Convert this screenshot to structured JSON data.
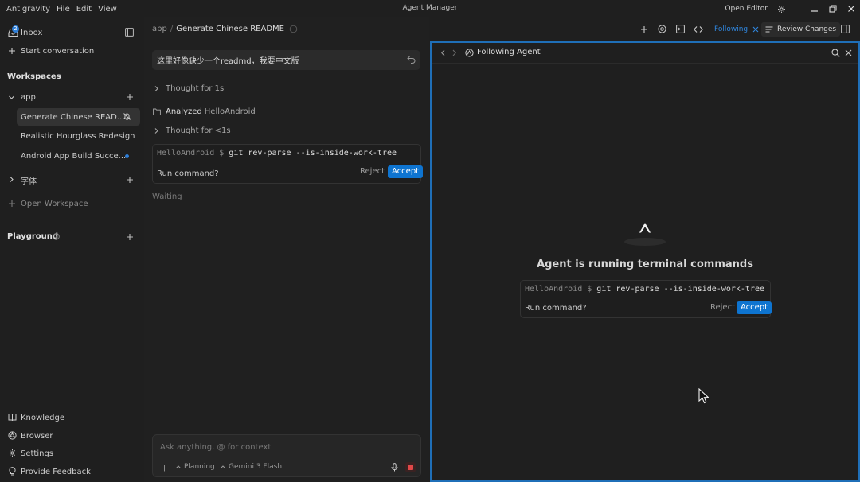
{
  "titlebar": {
    "menu": [
      "Antigravity",
      "File",
      "Edit",
      "View"
    ],
    "center_title": "Agent Manager",
    "open_editor": "Open Editor"
  },
  "sidebar": {
    "inbox_label": "Inbox",
    "inbox_badge": "2",
    "start_conversation": "Start conversation",
    "workspaces_title": "Workspaces",
    "workspaces": [
      {
        "name": "app",
        "items": [
          {
            "label": "Generate Chinese READ..."
          },
          {
            "label": "Realistic Hourglass Redesign"
          },
          {
            "label": "Android App Build Succe..."
          }
        ]
      },
      {
        "name": "字体"
      }
    ],
    "open_workspace": "Open Workspace",
    "playground_title": "Playground",
    "bottom": [
      "Knowledge",
      "Browser",
      "Settings",
      "Provide Feedback"
    ]
  },
  "chat": {
    "breadcrumb": [
      "app",
      "Generate Chinese README"
    ],
    "user_message": "这里好像缺少一个readmd，我要中文版",
    "steps": {
      "thought1": "Thought for 1s",
      "analyzed_prefix": "Analyzed",
      "analyzed_target": "HelloAndroid",
      "thought2": "Thought for <1s"
    },
    "command": {
      "prompt": "HelloAndroid $",
      "text": "git rev-parse --is-inside-work-tree",
      "run_label": "Run command?",
      "reject": "Reject",
      "accept": "Accept"
    },
    "status": "Waiting",
    "composer": {
      "placeholder": "Ask anything, @ for context",
      "mode": "Planning",
      "model": "Gemini 3 Flash"
    }
  },
  "toolbar": {
    "following": "Following",
    "review_changes": "Review Changes"
  },
  "agent_panel": {
    "title": "Following Agent",
    "heading": "Agent is running terminal commands",
    "command": {
      "prompt": "HelloAndroid $",
      "text": "git rev-parse --is-inside-work-tree",
      "run_label": "Run command?",
      "reject": "Reject",
      "accept": "Accept"
    }
  }
}
